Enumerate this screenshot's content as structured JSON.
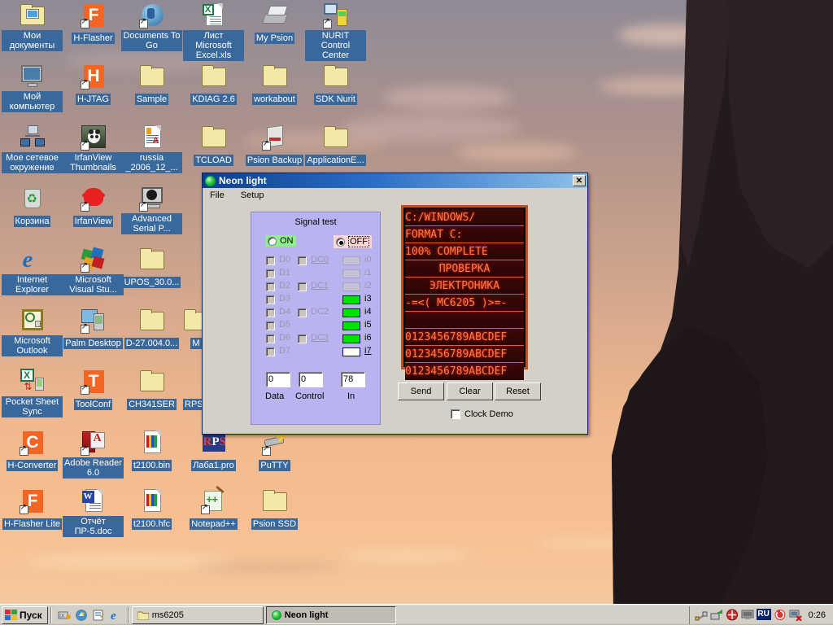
{
  "desktop": {
    "icons": [
      {
        "name": "Мои документы",
        "type": "folder-special",
        "col": 0,
        "row": 0
      },
      {
        "name": "H-Flasher",
        "type": "app-orange",
        "letter": "F",
        "col": 1,
        "row": 0
      },
      {
        "name": "Documents To Go",
        "type": "app-blue",
        "col": 2,
        "row": 0
      },
      {
        "name": "Лист Microsoft Excel.xls",
        "type": "excel-doc",
        "col": 3,
        "row": 0
      },
      {
        "name": "My Psion",
        "type": "psion",
        "col": 4,
        "row": 0
      },
      {
        "name": "NURIT Control Center",
        "type": "nurit",
        "col": 5,
        "row": 0
      },
      {
        "name": "Мой компьютер",
        "type": "computer",
        "col": 0,
        "row": 1
      },
      {
        "name": "H-JTAG",
        "type": "app-orange",
        "letter": "H",
        "col": 1,
        "row": 1
      },
      {
        "name": "Sample",
        "type": "folder",
        "col": 2,
        "row": 1
      },
      {
        "name": "KDIAG 2.6",
        "type": "folder",
        "col": 3,
        "row": 1
      },
      {
        "name": "workabout",
        "type": "folder",
        "col": 4,
        "row": 1
      },
      {
        "name": "SDK Nurit",
        "type": "folder",
        "col": 5,
        "row": 1
      },
      {
        "name": "Мое сетевое окружение",
        "type": "network",
        "col": 0,
        "row": 2
      },
      {
        "name": "IrfanView Thumbnails",
        "type": "panda",
        "col": 1,
        "row": 2
      },
      {
        "name": "russia _2006_12_...",
        "type": "word-doc",
        "col": 2,
        "row": 2
      },
      {
        "name": "TCLOAD",
        "type": "folder",
        "col": 3,
        "row": 2
      },
      {
        "name": "Psion Backup",
        "type": "backup",
        "col": 4,
        "row": 2
      },
      {
        "name": "ApplicationE...",
        "type": "folder",
        "col": 5,
        "row": 2
      },
      {
        "name": "Корзина",
        "type": "recycle",
        "col": 0,
        "row": 3
      },
      {
        "name": "IrfanView",
        "type": "irfan",
        "col": 1,
        "row": 3
      },
      {
        "name": "Advanced Serial P...",
        "type": "serial",
        "col": 2,
        "row": 3
      },
      {
        "name": "Internet Explorer",
        "type": "ie",
        "col": 0,
        "row": 4
      },
      {
        "name": "Microsoft Visual Stu...",
        "type": "msvs",
        "col": 1,
        "row": 4
      },
      {
        "name": "UPOS_30.0...",
        "type": "folder",
        "col": 2,
        "row": 4
      },
      {
        "name": "Microsoft Outlook",
        "type": "outlook",
        "col": 0,
        "row": 5
      },
      {
        "name": "Palm Desktop",
        "type": "palm",
        "col": 1,
        "row": 5
      },
      {
        "name": "D-27.004.0...",
        "type": "folder",
        "col": 2,
        "row": 5
      },
      {
        "name": "Pocket Sheet Sync",
        "type": "pocketsheet",
        "col": 0,
        "row": 6
      },
      {
        "name": "ToolConf",
        "type": "app-orange",
        "letter": "T",
        "col": 1,
        "row": 6
      },
      {
        "name": "CH341SER",
        "type": "folder",
        "col": 2,
        "row": 6
      },
      {
        "name": "H-Converter",
        "type": "app-orange",
        "letter": "C",
        "col": 0,
        "row": 7
      },
      {
        "name": "Adobe Reader 6.0",
        "type": "acrobat",
        "col": 1,
        "row": 7
      },
      {
        "name": "t2100.bin",
        "type": "bin-doc",
        "col": 2,
        "row": 7
      },
      {
        "name": "Лаба1.pro",
        "type": "rps",
        "col": 3,
        "row": 7
      },
      {
        "name": "PuTTY",
        "type": "putty",
        "col": 4,
        "row": 7
      },
      {
        "name": "H-Flasher Lite",
        "type": "app-orange",
        "letter": "F",
        "col": 0,
        "row": 8
      },
      {
        "name": "Отчёт ПР-5.doc",
        "type": "word-doc",
        "col": 1,
        "row": 8
      },
      {
        "name": "t2100.hfc",
        "type": "bin-doc",
        "col": 2,
        "row": 8
      },
      {
        "name": "Notepad++",
        "type": "notepadpp",
        "col": 3,
        "row": 8
      },
      {
        "name": "Psion SSD",
        "type": "folder",
        "col": 4,
        "row": 8
      }
    ]
  },
  "taskbar": {
    "start_label": "Пуск",
    "quick_launch": [
      "show-desktop-icon",
      "irfanview-quick-icon",
      "notepad-quick-icon",
      "internet-explorer-icon"
    ],
    "tasks": [
      {
        "label": "ms6205",
        "icon": "folder-icon",
        "active": false
      },
      {
        "label": "Neon light",
        "icon": "neon-icon",
        "active": true
      }
    ],
    "tray_icons": [
      "usb-cable-icon",
      "safely-remove-icon",
      "antivirus-icon",
      "monitor-icon",
      "language-indicator",
      "sync-icon",
      "network-disconnected-icon"
    ],
    "language": "RU",
    "clock": "0:26"
  },
  "window": {
    "title": "Neon light",
    "title_icon": "neon-light-icon",
    "close_label": "✕",
    "menu": [
      "File",
      "Setup"
    ],
    "signal_test": {
      "title": "Signal test",
      "radios": [
        {
          "label": "ON",
          "selected": false,
          "highlight": "#90ee90"
        },
        {
          "label": "OFF",
          "selected": true,
          "highlight": "#ffd5d5"
        }
      ],
      "data_checkboxes": [
        "D0",
        "D1",
        "D2",
        "D3",
        "D4",
        "D5",
        "D6",
        "D7"
      ],
      "control_checkboxes": [
        "DC0",
        "DC1",
        "DC2",
        "DC3"
      ],
      "inputs": [
        {
          "label": "i0",
          "state": "off"
        },
        {
          "label": "i1",
          "state": "off"
        },
        {
          "label": "i2",
          "state": "off"
        },
        {
          "label": "i3",
          "state": "on"
        },
        {
          "label": "i4",
          "state": "on"
        },
        {
          "label": "i5",
          "state": "on"
        },
        {
          "label": "i6",
          "state": "on"
        },
        {
          "label": "i7",
          "state": "blank"
        }
      ],
      "fields": [
        {
          "label": "Data",
          "value": "0"
        },
        {
          "label": "Control",
          "value": "0"
        },
        {
          "label": "In",
          "value": "78"
        }
      ]
    },
    "display": {
      "lines": [
        {
          "text": "C:/WINDOWS/",
          "align": "left"
        },
        {
          "text": "FORMAT C:",
          "align": "left"
        },
        {
          "text": "100% COMPLETE",
          "align": "left"
        },
        {
          "text": "ПРОВЕРКА",
          "align": "center"
        },
        {
          "text": "ЭЛЕКТРОНИКА",
          "align": "center"
        },
        {
          "text": "-=<( MC6205 )>=-",
          "align": "left"
        },
        {
          "text": " ",
          "align": "left"
        },
        {
          "text": "0123456789ABCDEF",
          "align": "left"
        },
        {
          "text": "0123456789ABCDEF",
          "align": "left"
        },
        {
          "text": "0123456789ABCDEF",
          "align": "left"
        }
      ],
      "color": "#ff7744",
      "bezel_color": "#b9521f"
    },
    "buttons": [
      "Send",
      "Clear",
      "Reset"
    ],
    "clock_demo": {
      "label": "Clock Demo",
      "checked": false
    }
  }
}
